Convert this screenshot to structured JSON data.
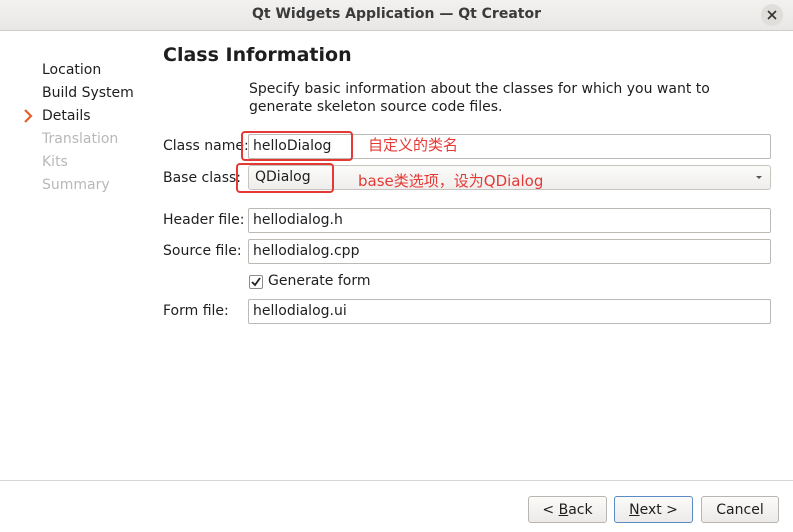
{
  "window": {
    "title": "Qt Widgets Application — Qt Creator"
  },
  "steps": [
    {
      "label": "Location",
      "state": "done"
    },
    {
      "label": "Build System",
      "state": "done"
    },
    {
      "label": "Details",
      "state": "current"
    },
    {
      "label": "Translation",
      "state": "disabled"
    },
    {
      "label": "Kits",
      "state": "disabled"
    },
    {
      "label": "Summary",
      "state": "disabled"
    }
  ],
  "page": {
    "title": "Class Information",
    "description": "Specify basic information about the classes for which you want to generate skeleton source code files."
  },
  "form": {
    "class_name_label": "Class name:",
    "class_name_value": "helloDialog",
    "base_class_label": "Base class:",
    "base_class_value": "QDialog",
    "header_file_label": "Header file:",
    "header_file_value": "hellodialog.h",
    "source_file_label": "Source file:",
    "source_file_value": "hellodialog.cpp",
    "generate_form_label": "Generate form",
    "generate_form_checked": true,
    "form_file_label": "Form file:",
    "form_file_value": "hellodialog.ui"
  },
  "annotations": {
    "class_name_note": "自定义的类名",
    "base_class_note": "base类选项，设为QDialog",
    "color": "#e53935"
  },
  "buttons": {
    "back_prefix": "< ",
    "back_key": "B",
    "back_rest": "ack",
    "next_key": "N",
    "next_rest": "ext >",
    "cancel": "Cancel"
  }
}
